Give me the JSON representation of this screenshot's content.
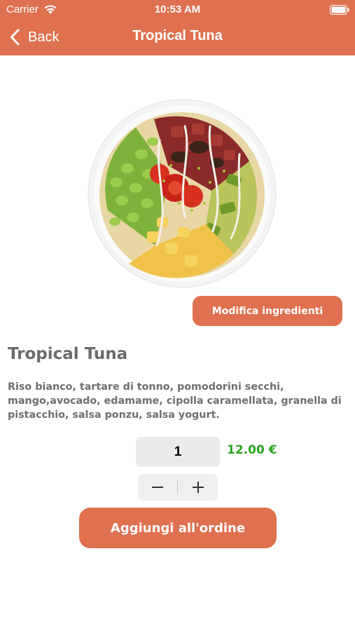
{
  "status_bar": {
    "carrier": "Carrier",
    "time": "10:53 AM"
  },
  "nav": {
    "back_label": "Back",
    "title": "Tropical Tuna"
  },
  "product": {
    "modify_button": "Modifica ingredienti",
    "name": "Tropical Tuna",
    "description": "Riso bianco, tartare di tonno, pomodorini secchi, mango,avocado, edamame, cipolla caramellata, granella di pistacchio, salsa ponzu, salsa yogurt.",
    "quantity": "1",
    "price": "12.00 €",
    "add_to_order_button": "Aggiungi all'ordine"
  },
  "colors": {
    "accent": "#DF7150",
    "price": "#2AA51E",
    "text": "#6b6b6b"
  }
}
